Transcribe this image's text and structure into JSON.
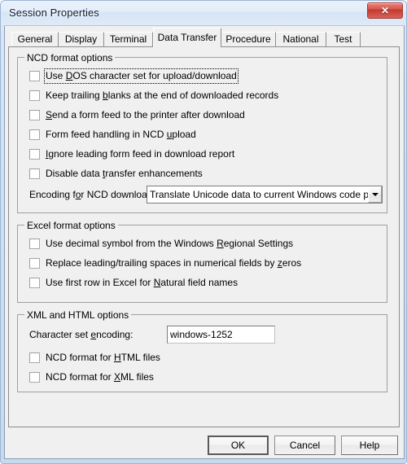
{
  "window": {
    "title": "Session Properties",
    "close_label": "✕",
    "close_icon": "close-icon"
  },
  "tabs": [
    {
      "label": "General",
      "active": false
    },
    {
      "label": "Display",
      "active": false
    },
    {
      "label": "Terminal",
      "active": false
    },
    {
      "label": "Data Transfer",
      "active": true
    },
    {
      "label": "Procedure",
      "active": false
    },
    {
      "label": "National",
      "active": false
    },
    {
      "label": "Test",
      "active": false
    }
  ],
  "groups": {
    "ncd": {
      "title": "NCD format options",
      "checkboxes": [
        {
          "pre": "Use ",
          "accel": "D",
          "post": "OS character set for upload/download",
          "checked": false,
          "focused": true
        },
        {
          "pre": "Keep trailing ",
          "accel": "b",
          "post": "lanks at the end of downloaded records",
          "checked": false,
          "focused": false
        },
        {
          "pre": "",
          "accel": "S",
          "post": "end a form feed to the printer after download",
          "checked": false,
          "focused": false
        },
        {
          "pre": "Form feed handling in NCD ",
          "accel": "u",
          "post": "pload",
          "checked": false,
          "focused": false
        },
        {
          "pre": "",
          "accel": "I",
          "post": "gnore leading form feed in download report",
          "checked": false,
          "focused": false
        },
        {
          "pre": "Disable data ",
          "accel": "t",
          "post": "ransfer enhancements",
          "checked": false,
          "focused": false
        }
      ],
      "encoding_label": {
        "pre": "Encoding for NCD download:",
        "accel": "o",
        "label_full": "Encoding for NCD download:"
      },
      "encoding_combo": {
        "value": "Translate Unicode data to current Windows code page",
        "arrow_icon": "chevron-down-icon"
      }
    },
    "excel": {
      "title": "Excel format options",
      "checkboxes": [
        {
          "pre": "Use decimal symbol from the Windows ",
          "accel": "R",
          "post": "egional Settings",
          "checked": false,
          "focused": false
        },
        {
          "pre": "Replace leading/trailing spaces in numerical fields by ",
          "accel": "z",
          "post": "eros",
          "checked": false,
          "focused": false
        },
        {
          "pre": "Use first row in Excel for ",
          "accel": "N",
          "post": "atural field names",
          "checked": false,
          "focused": false
        }
      ]
    },
    "xmlhtml": {
      "title": "XML and HTML options",
      "charset_label": {
        "pre": "Character set ",
        "accel": "e",
        "post": "ncoding:"
      },
      "charset_value": "windows-1252",
      "checkboxes": [
        {
          "pre": "NCD format for ",
          "accel": "H",
          "post": "TML files",
          "checked": false,
          "focused": false
        },
        {
          "pre": "NCD format for ",
          "accel": "X",
          "post": "ML files",
          "checked": false,
          "focused": false
        }
      ]
    }
  },
  "buttons": [
    {
      "label": "OK",
      "default": true
    },
    {
      "label": "Cancel",
      "default": false
    },
    {
      "label": "Help",
      "default": false
    }
  ],
  "colors": {
    "dialog_face": "#f0f0f0",
    "aero_frame": "#cfe0f2",
    "close_red": "#c1392e",
    "group_border": "#a0a0a0"
  }
}
